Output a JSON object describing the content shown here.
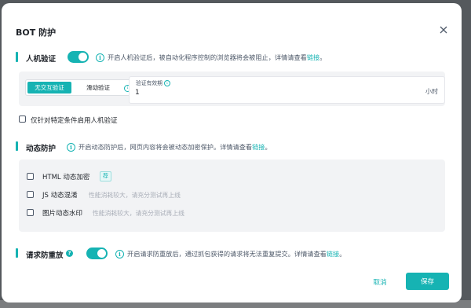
{
  "dialog": {
    "title": "BOT 防护",
    "close_icon": "close-icon"
  },
  "human_verification": {
    "title": "人机验证",
    "enabled": true,
    "hint_text": "开启人机验证后，被自动化程序控制的浏览器将会被阻止，详情请查看",
    "hint_link": "链接",
    "hint_end": "。",
    "modes": {
      "active": "无交互验证",
      "other": "滑动验证"
    },
    "validity": {
      "label": "验证有效期",
      "value": "1",
      "unit": "小时"
    },
    "conditional_checkbox": {
      "label": "仅针对特定条件启用人机验证",
      "checked": false
    }
  },
  "dynamic_protection": {
    "title": "动态防护",
    "hint_text": "开启动态防护后，网页内容将会被动态加密保护。详情请查看",
    "hint_link": "链接",
    "hint_end": "。",
    "options": [
      {
        "label": "HTML 动态加密",
        "badge": "荐",
        "desc": "",
        "checked": false
      },
      {
        "label": "JS 动态混淆",
        "badge": "",
        "desc": "性能消耗较大，请充分测试再上线",
        "checked": false
      },
      {
        "label": "图片动态水印",
        "badge": "",
        "desc": "性能消耗较大，请充分测试再上线",
        "checked": false
      }
    ]
  },
  "replay_protection": {
    "title": "请求防重放",
    "help_icon": "help-icon",
    "enabled": true,
    "hint_text": "开启请求防重放后，通过抓包获得的请求将无法重复提交。详情请查看",
    "hint_link": "链接",
    "hint_end": "。"
  },
  "footer": {
    "cancel_label": "取消",
    "save_label": "保存"
  },
  "colors": {
    "accent": "#16b3b3",
    "panel_bg": "#f2f3f5"
  }
}
